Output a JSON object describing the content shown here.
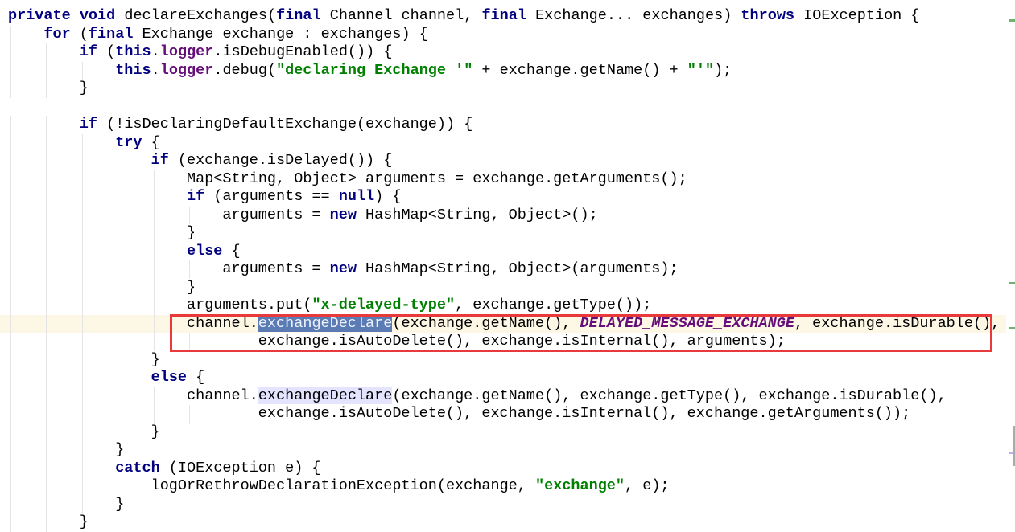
{
  "editor": {
    "current_line": 17,
    "highlight_box_lines": [
      17,
      18
    ],
    "colors": {
      "keyword": "#000080",
      "field": "#660e7a",
      "string": "#008000",
      "selection": "#5b7bb4",
      "usage_highlight": "#e4e4ff",
      "current_line": "#fdf8e6",
      "box": "#e83a3a"
    },
    "lines": [
      {
        "indent": 0,
        "tokens": [
          [
            "private",
            "k"
          ],
          " ",
          [
            "void",
            "k"
          ],
          " declareExchanges(",
          [
            "final",
            "k"
          ],
          " Channel channel, ",
          [
            "final",
            "k"
          ],
          " Exchange... exchanges) ",
          [
            "throws",
            "k"
          ],
          " IOException {"
        ]
      },
      {
        "indent": 4,
        "tokens": [
          [
            "for",
            "k"
          ],
          " (",
          [
            "final",
            "k"
          ],
          " Exchange exchange : exchanges) {"
        ]
      },
      {
        "indent": 8,
        "tokens": [
          [
            "if",
            "k"
          ],
          " (",
          [
            "this",
            "k"
          ],
          ".",
          [
            "logger",
            "f"
          ],
          ".isDebugEnabled()) {"
        ]
      },
      {
        "indent": 12,
        "tokens": [
          [
            "this",
            "k"
          ],
          ".",
          [
            "logger",
            "f"
          ],
          ".debug(",
          [
            "\"declaring Exchange '\"",
            "s"
          ],
          " + exchange.getName() + ",
          [
            "\"'\"",
            "s"
          ],
          ");"
        ]
      },
      {
        "indent": 8,
        "tokens": [
          "}"
        ]
      },
      {
        "indent": 0,
        "tokens": []
      },
      {
        "indent": 8,
        "tokens": [
          [
            "if",
            "k"
          ],
          " (!isDeclaringDefaultExchange(exchange)) {"
        ]
      },
      {
        "indent": 12,
        "tokens": [
          [
            "try",
            "k"
          ],
          " {"
        ]
      },
      {
        "indent": 16,
        "tokens": [
          [
            "if",
            "k"
          ],
          " (exchange.isDelayed()) {"
        ]
      },
      {
        "indent": 20,
        "tokens": [
          "Map<String, Object> arguments = exchange.getArguments();"
        ]
      },
      {
        "indent": 20,
        "tokens": [
          [
            "if",
            "k"
          ],
          " (arguments == ",
          [
            "null",
            "k"
          ],
          ") {"
        ]
      },
      {
        "indent": 24,
        "tokens": [
          "arguments = ",
          [
            "new",
            "k"
          ],
          " HashMap<String, Object>();"
        ]
      },
      {
        "indent": 20,
        "tokens": [
          "}"
        ]
      },
      {
        "indent": 20,
        "tokens": [
          [
            "else",
            "k"
          ],
          " {"
        ]
      },
      {
        "indent": 24,
        "tokens": [
          "arguments = ",
          [
            "new",
            "k"
          ],
          " HashMap<String, Object>(arguments);"
        ]
      },
      {
        "indent": 20,
        "tokens": [
          "}"
        ]
      },
      {
        "indent": 20,
        "tokens": [
          "arguments.put(",
          [
            "\"x-delayed-type\"",
            "s"
          ],
          ", exchange.getType());"
        ]
      },
      {
        "indent": 20,
        "tokens": [
          "channel.",
          [
            "exchangeDeclare",
            "sel"
          ],
          "(exchange.getName(), ",
          [
            "DELAYED_MESSAGE_EXCHANGE",
            "c"
          ],
          ", exchange.isDurable(),"
        ]
      },
      {
        "indent": 28,
        "tokens": [
          "exchange.isAutoDelete(), exchange.isInternal(), arguments);"
        ]
      },
      {
        "indent": 16,
        "tokens": [
          "}"
        ]
      },
      {
        "indent": 16,
        "tokens": [
          [
            "else",
            "k"
          ],
          " {"
        ]
      },
      {
        "indent": 20,
        "tokens": [
          "channel.",
          [
            "exchangeDeclare",
            "sel2"
          ],
          "(exchange.getName(), exchange.getType(), exchange.isDurable(),"
        ]
      },
      {
        "indent": 28,
        "tokens": [
          "exchange.isAutoDelete(), exchange.isInternal(), exchange.getArguments());"
        ]
      },
      {
        "indent": 16,
        "tokens": [
          "}"
        ]
      },
      {
        "indent": 12,
        "tokens": [
          "}"
        ]
      },
      {
        "indent": 12,
        "tokens": [
          [
            "catch",
            "k"
          ],
          " (IOException e) {"
        ]
      },
      {
        "indent": 16,
        "tokens": [
          "logOrRethrowDeclarationException(exchange, ",
          [
            "\"exchange\"",
            "s"
          ],
          ", e);"
        ]
      },
      {
        "indent": 12,
        "tokens": [
          "}"
        ]
      },
      {
        "indent": 8,
        "tokens": [
          "}"
        ]
      }
    ]
  },
  "gutter_markers": [
    {
      "line": 0,
      "kind": "change"
    },
    {
      "line": 15,
      "kind": "change"
    },
    {
      "line": 17,
      "kind": "change"
    },
    {
      "line": 24,
      "kind": "usage"
    }
  ]
}
